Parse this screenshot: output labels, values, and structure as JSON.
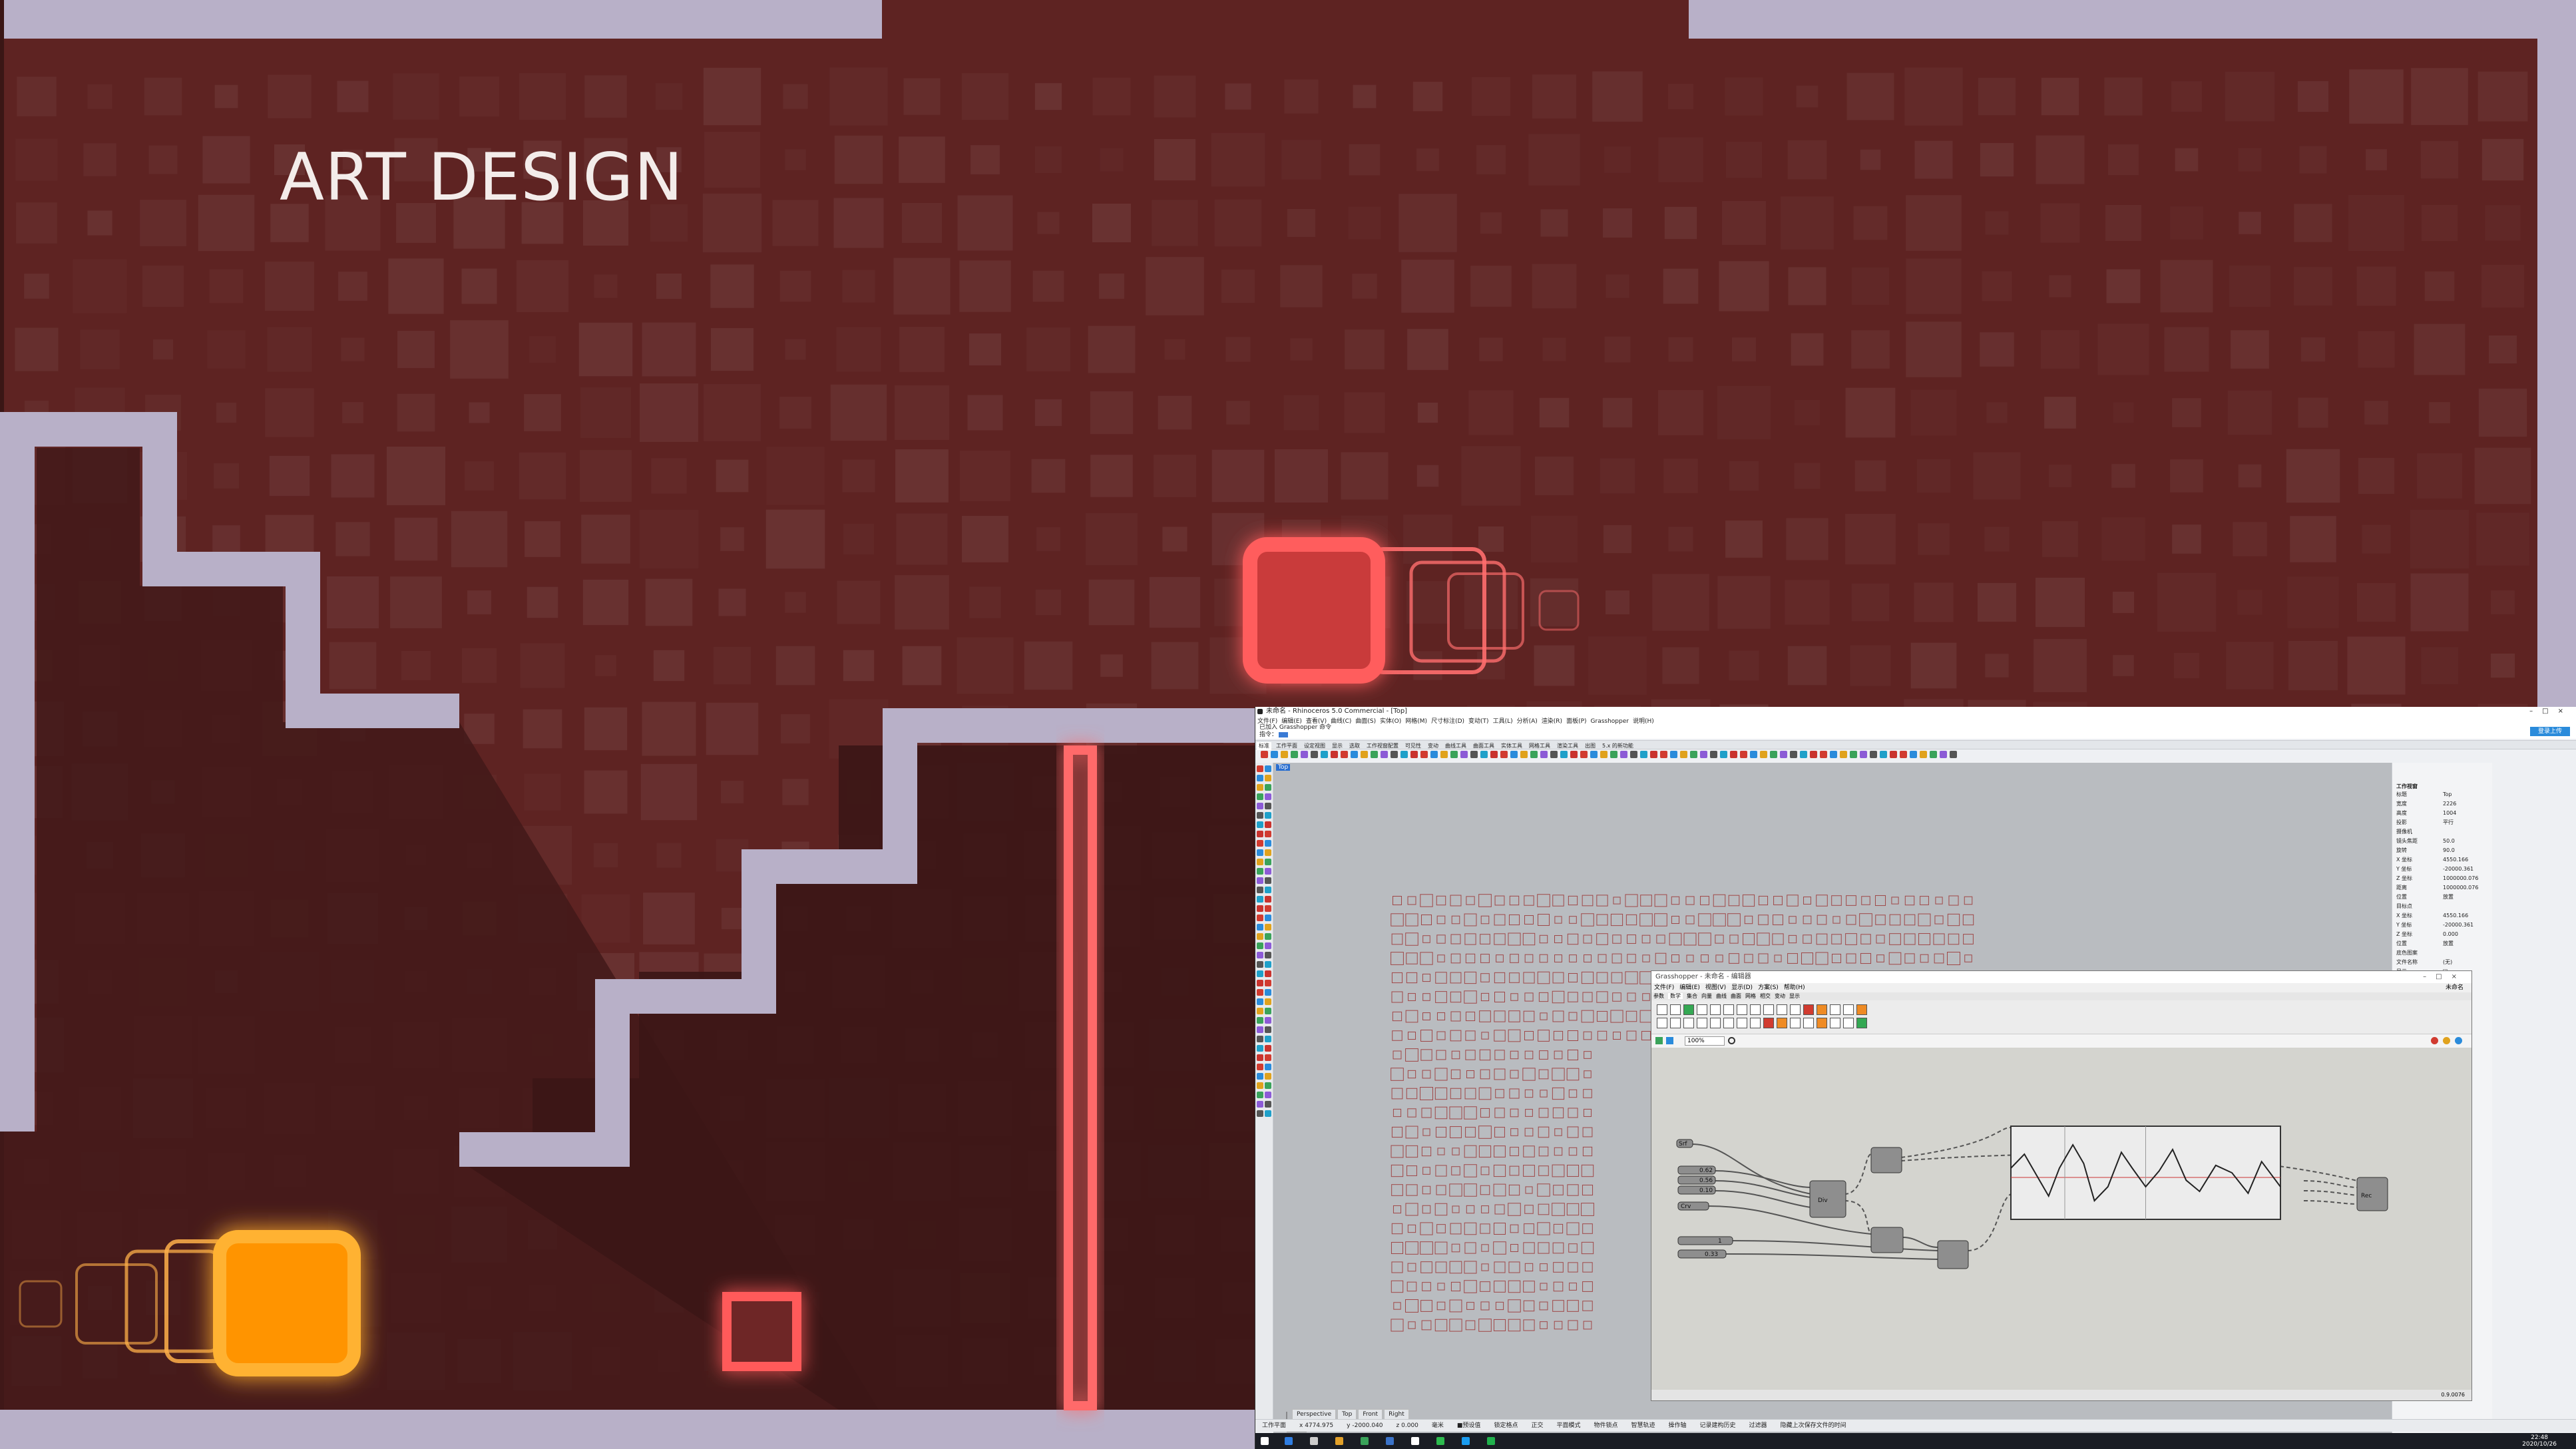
{
  "art": {
    "title": "ART DESIGN",
    "colors": {
      "frame": "#b8b0c8",
      "background": "#5e2322",
      "shadow": "#3f1818",
      "orange_glow": "#ff9a18",
      "red_glow": "#ff5555"
    }
  },
  "rhino": {
    "title": "未命名 - Rhinoceros 5.0 Commercial - [Top]",
    "window_buttons": [
      "–",
      "□",
      "×"
    ],
    "menu": [
      "文件(F)",
      "编辑(E)",
      "查看(V)",
      "曲线(C)",
      "曲面(S)",
      "实体(O)",
      "网格(M)",
      "尺寸标注(D)",
      "变动(T)",
      "工具(L)",
      "分析(A)",
      "渲染(R)",
      "面板(P)",
      "Grasshopper",
      "说明(H)"
    ],
    "command_history": "已加入 Grasshopper 命令",
    "command_prompt": "指令：",
    "login_label": "登录上传",
    "toolbar_tabs": [
      "标准",
      "工作平面",
      "设定视图",
      "显示",
      "选取",
      "工作视窗配置",
      "可见性",
      "变动",
      "曲线工具",
      "曲面工具",
      "实体工具",
      "网格工具",
      "渲染工具",
      "出图",
      "5.x 的新功能"
    ],
    "viewport_label": "Top",
    "view_tabs": [
      "Perspective",
      "Top",
      "Front",
      "Right"
    ],
    "properties": {
      "section_title": "工作视窗",
      "rows": [
        [
          "标题",
          "Top"
        ],
        [
          "宽度",
          "2226"
        ],
        [
          "高度",
          "1004"
        ],
        [
          "投影",
          "平行"
        ],
        [
          "摄像机",
          ""
        ],
        [
          "镜头焦距",
          "50.0"
        ],
        [
          "旋转",
          "90.0"
        ],
        [
          "X 坐标",
          "4550.166"
        ],
        [
          "Y 坐标",
          "-20000.361"
        ],
        [
          "Z 坐标",
          "1000000.076"
        ],
        [
          "距离",
          "1000000.076"
        ],
        [
          "位置",
          "放置"
        ],
        [
          "目标点",
          ""
        ],
        [
          "X 坐标",
          "4550.166"
        ],
        [
          "Y 坐标",
          "-20000.361"
        ],
        [
          "Z 坐标",
          "0.000"
        ],
        [
          "位置",
          "放置"
        ],
        [
          "底色图案",
          ""
        ],
        [
          "文件名称",
          "(无)"
        ],
        [
          "显示",
          "☑"
        ],
        [
          "灰阶",
          "☑"
        ]
      ]
    },
    "status_bar": [
      "工作平面",
      "x 4774.975",
      "y -2000.040",
      "z 0.000",
      "毫米",
      "■预设值",
      "锁定格点",
      "正交",
      "平面模式",
      "物件锁点",
      "智慧轨迹",
      "操作轴",
      "记录建构历史",
      "过滤器",
      "隐藏上次保存文件的时间"
    ],
    "clock": {
      "time": "22:48",
      "date": "2020/10/26"
    },
    "taskbar_icon_colors": [
      "#2f7de1",
      "#cccccc",
      "#e2a029",
      "#3aa35a",
      "#3b73c9",
      "#ffffff",
      "#2dbb4e",
      "#1a9cf0",
      "#20b14c"
    ]
  },
  "grasshopper": {
    "title": "Grasshopper - 未命名 - 编辑器",
    "window_buttons": [
      "–",
      "□",
      "×"
    ],
    "menu": [
      "文件(F)",
      "编辑(E)",
      "视图(V)",
      "显示(D)",
      "方案(S)",
      "帮助(H)"
    ],
    "file_label": "未命名",
    "tabs": [
      "参数",
      "数学",
      "集合",
      "向量",
      "曲线",
      "曲面",
      "网格",
      "相交",
      "变动",
      "显示"
    ],
    "active_tab": "数学",
    "zoom": "100%",
    "version": "0.9.0076",
    "graph_mapper_path": [
      [
        0,
        0.55
      ],
      [
        0.05,
        0.7
      ],
      [
        0.1,
        0.45
      ],
      [
        0.14,
        0.25
      ],
      [
        0.18,
        0.55
      ],
      [
        0.23,
        0.8
      ],
      [
        0.27,
        0.6
      ],
      [
        0.31,
        0.2
      ],
      [
        0.36,
        0.35
      ],
      [
        0.41,
        0.72
      ],
      [
        0.45,
        0.55
      ],
      [
        0.5,
        0.35
      ],
      [
        0.55,
        0.52
      ],
      [
        0.6,
        0.75
      ],
      [
        0.65,
        0.42
      ],
      [
        0.7,
        0.3
      ],
      [
        0.76,
        0.58
      ],
      [
        0.82,
        0.5
      ],
      [
        0.88,
        0.28
      ],
      [
        0.93,
        0.62
      ],
      [
        1,
        0.35
      ]
    ],
    "nodes": [
      {
        "name": "src-node",
        "label": "Srf"
      },
      {
        "name": "slider-node-1",
        "label": "0.62"
      },
      {
        "name": "slider-node-2",
        "label": "0.56"
      },
      {
        "name": "slider-node-3",
        "label": "0.10"
      },
      {
        "name": "panel-node",
        "label": "Crv"
      },
      {
        "name": "slider-node-4",
        "label": "1"
      },
      {
        "name": "slider-node-5",
        "label": "0.33"
      },
      {
        "name": "division-node",
        "label": "Div"
      },
      {
        "name": "graph-node",
        "label": "Graph"
      },
      {
        "name": "output-node",
        "label": "Rec"
      }
    ]
  }
}
